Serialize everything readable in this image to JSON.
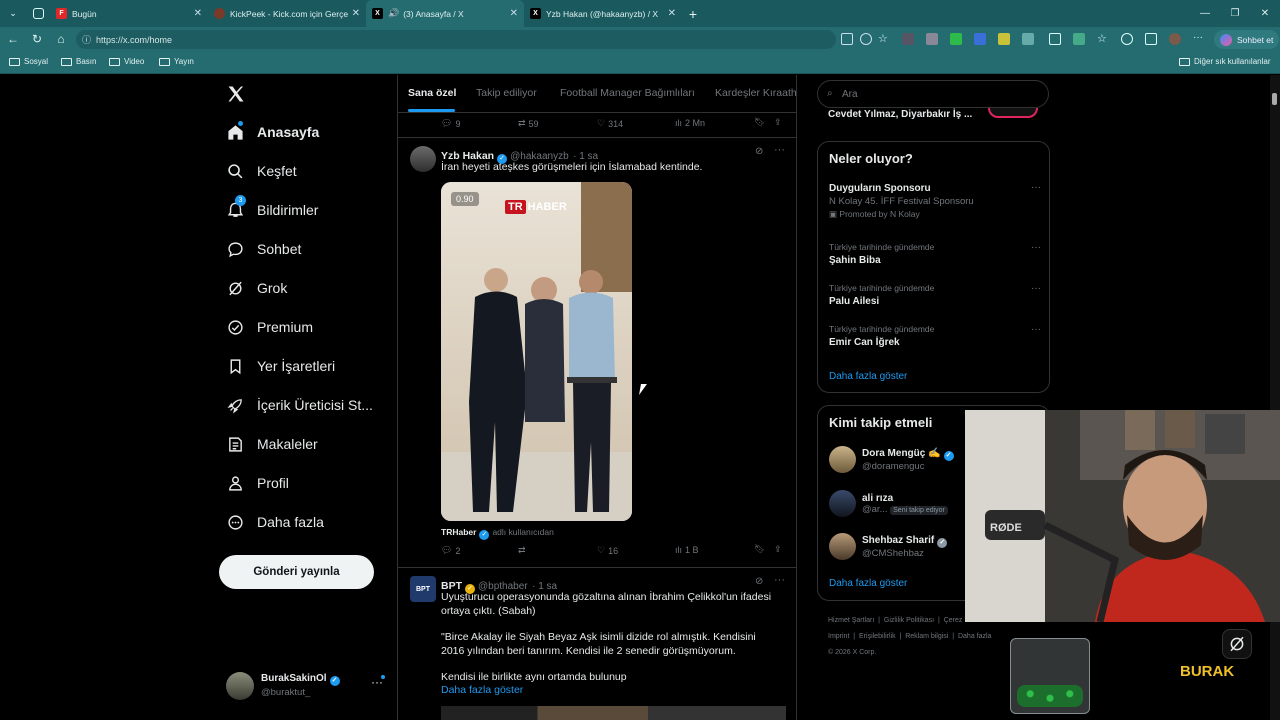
{
  "browser": {
    "tabs": [
      {
        "label": "Bugün",
        "icon": "flipboard-icon",
        "color": "#e12828"
      },
      {
        "label": "KickPeek - Kick.com için Gerçek Zam",
        "icon": "kickpeek-icon",
        "color": "#7a3a2a"
      },
      {
        "label": "(3) Anasayfa / X",
        "icon": "x-logo-icon",
        "color": "#000000"
      },
      {
        "label": "Yzb Hakan (@hakaanyzb) / X",
        "icon": "x-logo-icon",
        "color": "#000000"
      }
    ],
    "url": "https://x.com/home",
    "sohbet_label": "Sohbet et",
    "bookmarks": [
      "Sosyal",
      "Basın",
      "Video",
      "Yayın"
    ],
    "other_bookmarks": "Diğer sık kullanılanlar"
  },
  "nav": {
    "items": [
      {
        "label": "Anasayfa",
        "icon": "home-icon"
      },
      {
        "label": "Keşfet",
        "icon": "search-icon"
      },
      {
        "label": "Bildirimler",
        "icon": "bell-icon",
        "badge": "3"
      },
      {
        "label": "Sohbet",
        "icon": "chat-icon"
      },
      {
        "label": "Grok",
        "icon": "grok-icon"
      },
      {
        "label": "Premium",
        "icon": "premium-icon"
      },
      {
        "label": "Yer İşaretleri",
        "icon": "bookmark-icon"
      },
      {
        "label": "İçerik Üreticisi St...",
        "icon": "rocket-icon"
      },
      {
        "label": "Makaleler",
        "icon": "article-icon"
      },
      {
        "label": "Profil",
        "icon": "person-icon"
      },
      {
        "label": "Daha fazla",
        "icon": "more-circle-icon"
      }
    ],
    "post_button": "Gönderi yayınla",
    "account": {
      "name": "BurakSakinOl",
      "handle": "@buraktut_"
    }
  },
  "feed": {
    "tabs": [
      "Sana özel",
      "Takip ediliyor",
      "Football Manager Bağımlıları",
      "Kardeşler Kıraath"
    ],
    "prev_actions": {
      "replies": "9",
      "reposts": "59",
      "likes": "314",
      "views": "2 Mn"
    },
    "tweet1": {
      "name": "Yzb Hakan",
      "handle": "@hakaanyzb",
      "time": "· 1 sa",
      "text": "İran heyeti ateşkes görüşmeleri için İslamabad kentinde.",
      "media_rate": "0.90",
      "media_logo_tr": "TR",
      "media_logo_haber": "HABER",
      "credit_name": "TRHaber",
      "credit_suffix": "adlı kullanıcıdan",
      "replies": "2",
      "reposts": "",
      "likes": "16",
      "views": "1 B"
    },
    "tweet2": {
      "name": "BPT",
      "handle": "@bpthaber",
      "time": "· 1 sa",
      "text1": "Uyuşturucu operasyonunda gözaltına alınan İbrahim Çelikkol'un ifadesi ortaya çıktı. (Sabah)",
      "text2": "\"Birce Akalay ile Siyah Beyaz Aşk isimli dizide rol almıştık. Kendisini 2016 yılından beri tanırım. Kendisi ile 2 senedir görüşmüyorum.",
      "text3": "Kendisi ile birlikte aynı ortamda bulunup",
      "show_more": "Daha fazla göster"
    }
  },
  "right": {
    "search_placeholder": "Ara",
    "top_item": "Cevdet Yılmaz, Diyarbakır İş ...",
    "whats_happening": {
      "title": "Neler oluyor?",
      "trends": [
        {
          "category": "",
          "title": "Duyguların Sponsoru",
          "sub": "N Kolay 45. İFF Festival Sponsoru",
          "promoted": "Promoted by N Kolay"
        },
        {
          "category": "Türkiye tarihinde gündemde",
          "title": "Şahin Biba"
        },
        {
          "category": "Türkiye tarihinde gündemde",
          "title": "Palu Ailesi"
        },
        {
          "category": "Türkiye tarihinde gündemde",
          "title": "Emir Can İğrek"
        }
      ],
      "show_more": "Daha fazla göster"
    },
    "who_to_follow": {
      "title": "Kimi takip etmeli",
      "users": [
        {
          "name": "Dora Mengüç ✍",
          "handle": "@doramenguc"
        },
        {
          "name": "ali rıza",
          "handle": "@ar...",
          "badge": "Seni takip ediyor"
        },
        {
          "name": "Shehbaz Sharif",
          "handle": "@CMShehbaz"
        }
      ],
      "show_more": "Daha fazla göster"
    },
    "footer": [
      "Hizmet Şartları",
      "Gizlilik Politikası",
      "Çerez Politikası",
      "Imprint",
      "Erişilebilirlik",
      "Reklam bilgisi",
      "Daha fazla",
      "© 2026 X Corp."
    ]
  },
  "overlay": {
    "mic_label": "RØDE",
    "brand": "BURAK"
  },
  "colors": {
    "accent": "#1d9bf0",
    "chrome": "#246c70",
    "border": "#2f3336"
  }
}
